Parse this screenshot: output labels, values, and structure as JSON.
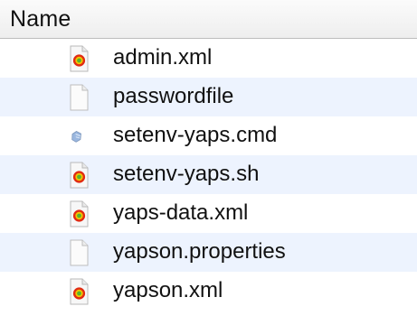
{
  "table": {
    "header": {
      "name_label": "Name"
    },
    "rows": [
      {
        "name": "admin.xml",
        "icon": "xml-file-icon"
      },
      {
        "name": "passwordfile",
        "icon": "blank-document-icon"
      },
      {
        "name": "setenv-yaps.cmd",
        "icon": "cmd-script-icon"
      },
      {
        "name": "setenv-yaps.sh",
        "icon": "xml-file-icon"
      },
      {
        "name": "yaps-data.xml",
        "icon": "xml-file-icon"
      },
      {
        "name": "yapson.properties",
        "icon": "blank-document-icon"
      },
      {
        "name": "yapson.xml",
        "icon": "xml-file-icon"
      }
    ]
  }
}
